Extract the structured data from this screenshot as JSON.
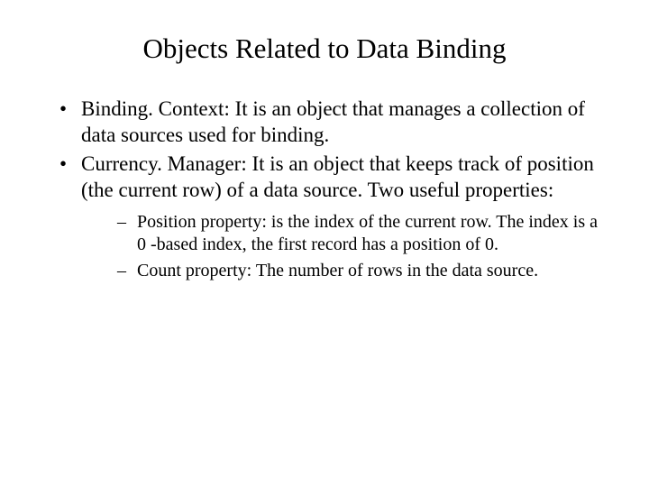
{
  "title": "Objects Related to Data Binding",
  "bullets": [
    "Binding. Context: It is an object that manages a collection of data sources used for binding.",
    "Currency. Manager: It is an object that keeps track of position (the current row) of a data source. Two useful properties:"
  ],
  "subbullets": [
    "Position property: is the index of the current row. The index is a 0 -based index, the first record has a position of 0.",
    "Count property: The number of rows in the data source."
  ]
}
